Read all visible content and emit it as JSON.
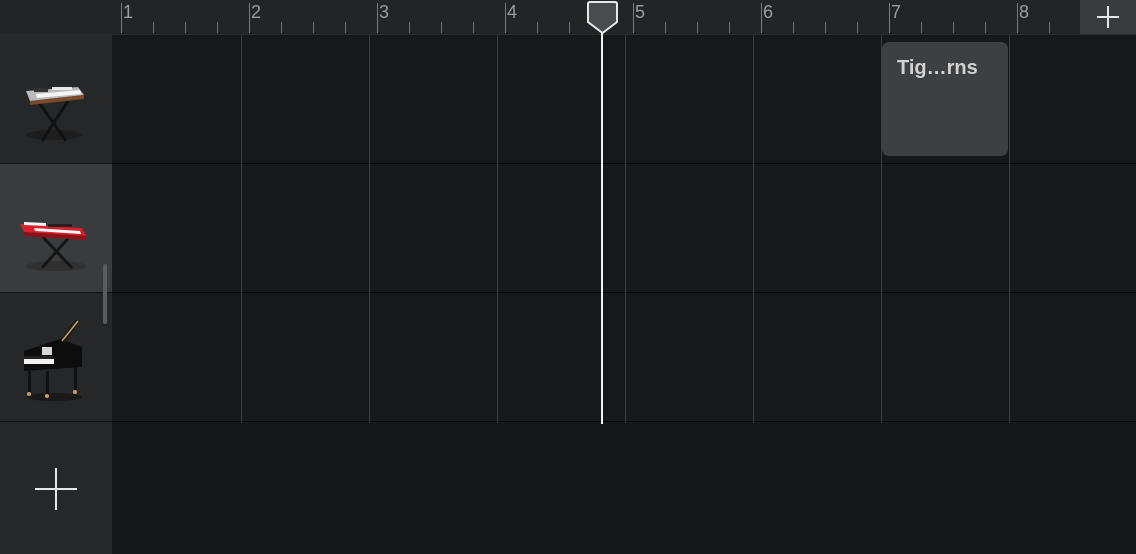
{
  "ruler": {
    "bars": [
      "1",
      "2",
      "3",
      "4",
      "5",
      "6",
      "7",
      "8"
    ],
    "add_section_icon": "plus-icon"
  },
  "tracks": [
    {
      "instrument": "electric-keyboard-icon",
      "selected": false
    },
    {
      "instrument": "red-synth-keyboard-icon",
      "selected": true
    },
    {
      "instrument": "grand-piano-icon",
      "selected": false
    }
  ],
  "add_track_icon": "plus-icon",
  "region": {
    "label": "Tig…rns",
    "track": 1
  },
  "playhead": {
    "bar": 4.8
  },
  "colors": {
    "background": "#161718",
    "ruler": "#232425",
    "region": "#3e3f40",
    "playhead": "#f2f2f2",
    "selected_track": "#3a3b3c"
  }
}
